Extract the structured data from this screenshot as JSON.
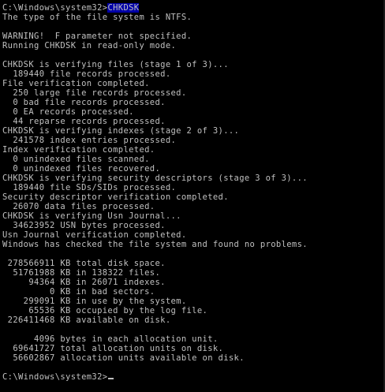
{
  "console": {
    "prompt_initial": "C:\\Windows\\system32>",
    "command": "CHKDSK",
    "lines": [
      "The type of the file system is NTFS.",
      "",
      "WARNING!  F parameter not specified.",
      "Running CHKDSK in read-only mode.",
      "",
      "CHKDSK is verifying files (stage 1 of 3)...",
      "  189440 file records processed.",
      "File verification completed.",
      "  250 large file records processed.",
      "  0 bad file records processed.",
      "  0 EA records processed.",
      "  44 reparse records processed.",
      "CHKDSK is verifying indexes (stage 2 of 3)...",
      "  241578 index entries processed.",
      "Index verification completed.",
      "  0 unindexed files scanned.",
      "  0 unindexed files recovered.",
      "CHKDSK is verifying security descriptors (stage 3 of 3)...",
      "  189440 file SDs/SIDs processed.",
      "Security descriptor verification completed.",
      "  26070 data files processed.",
      "CHKDSK is verifying Usn Journal...",
      "  34623952 USN bytes processed.",
      "Usn Journal verification completed.",
      "Windows has checked the file system and found no problems.",
      "",
      " 278566911 KB total disk space.",
      "  51761988 KB in 138322 files.",
      "     94364 KB in 26071 indexes.",
      "         0 KB in bad sectors.",
      "    299091 KB in use by the system.",
      "     65536 KB occupied by the log file.",
      " 226411468 KB available on disk.",
      "",
      "      4096 bytes in each allocation unit.",
      "  69641727 total allocation units on disk.",
      "  56602867 allocation units available on disk.",
      ""
    ],
    "prompt_final": "C:\\Windows\\system32>"
  }
}
